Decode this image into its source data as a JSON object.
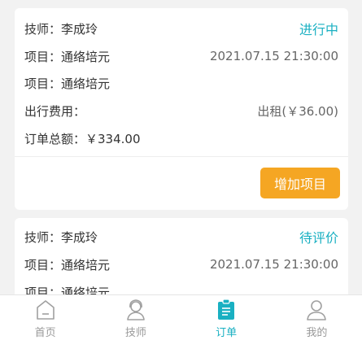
{
  "colors": {
    "accent": "#1ab0c2",
    "button": "#f5a623",
    "text": "#333333",
    "muted": "#999999"
  },
  "orders": [
    {
      "technician": "技师：李成玲",
      "status": "进行中",
      "item1": "项目：通络培元",
      "datetime": "2021.07.15 21:30:00",
      "item2": "项目：通络培元",
      "travel_fee_label": "出行费用：",
      "travel_fee_value": "出租(￥36.00)",
      "total": "订单总额：￥334.00",
      "add_button": "增加项目"
    },
    {
      "technician": "技师：李成玲",
      "status": "待评价",
      "item1": "项目：通络培元",
      "datetime": "2021.07.15 21:30:00",
      "item2": "项目：通络培元"
    }
  ],
  "tabbar": {
    "items": [
      {
        "label": "首页",
        "icon": "home-icon"
      },
      {
        "label": "技师",
        "icon": "technician-icon"
      },
      {
        "label": "订单",
        "icon": "clipboard-icon"
      },
      {
        "label": "我的",
        "icon": "profile-icon"
      }
    ],
    "active": "订单"
  }
}
